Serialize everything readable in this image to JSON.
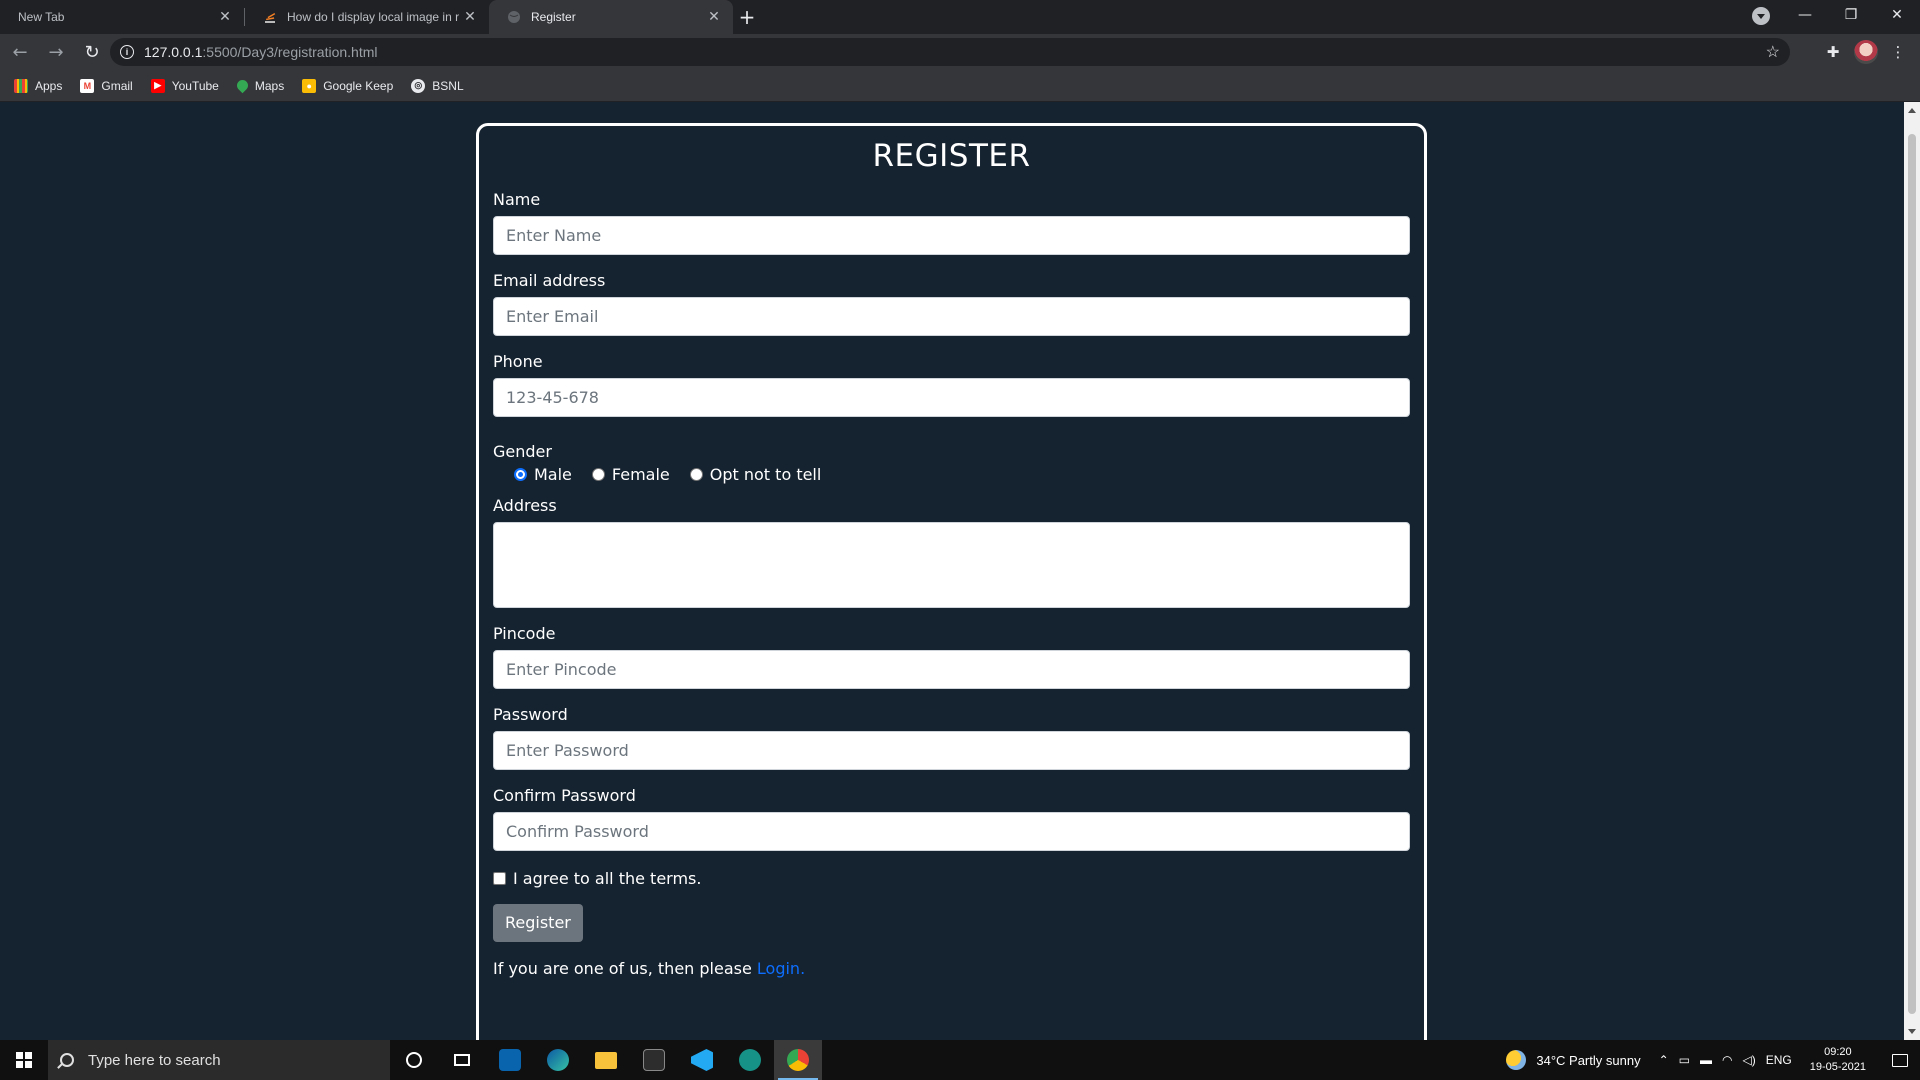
{
  "browser": {
    "tabs": [
      {
        "title": "New Tab",
        "active": false
      },
      {
        "title": "How do I display local image in r",
        "active": false
      },
      {
        "title": "Register",
        "active": true
      }
    ],
    "url_host": "127.0.0.1",
    "url_path": ":5500/Day3/registration.html",
    "bookmarks": [
      {
        "label": "Apps",
        "icon": "apps-grid-icon"
      },
      {
        "label": "Gmail",
        "icon": "gmail-icon"
      },
      {
        "label": "YouTube",
        "icon": "youtube-icon"
      },
      {
        "label": "Maps",
        "icon": "maps-icon"
      },
      {
        "label": "Google Keep",
        "icon": "keep-icon"
      },
      {
        "label": "BSNL",
        "icon": "bsnl-icon"
      }
    ]
  },
  "form": {
    "title": "REGISTER",
    "name_label": "Name",
    "name_placeholder": "Enter Name",
    "email_label": "Email address",
    "email_placeholder": "Enter Email",
    "phone_label": "Phone",
    "phone_placeholder": "123-45-678",
    "gender_label": "Gender",
    "gender_options": [
      "Male",
      "Female",
      "Opt not to tell"
    ],
    "gender_selected": "Male",
    "address_label": "Address",
    "pincode_label": "Pincode",
    "pincode_placeholder": "Enter Pincode",
    "password_label": "Password",
    "password_placeholder": "Enter Password",
    "confirm_label": "Confirm Password",
    "confirm_placeholder": "Confirm Password",
    "terms_label": "I agree to all the terms.",
    "submit_label": "Register",
    "footer_text": "If you are one of us, then please ",
    "login_link": "Login."
  },
  "taskbar": {
    "search_placeholder": "Type here to search",
    "weather": "34°C  Partly sunny",
    "lang": "ENG",
    "time": "09:20",
    "date": "19-05-2021"
  },
  "colors": {
    "page_bg": "#15222f",
    "link": "#0d6efd",
    "button": "#6c757d"
  }
}
